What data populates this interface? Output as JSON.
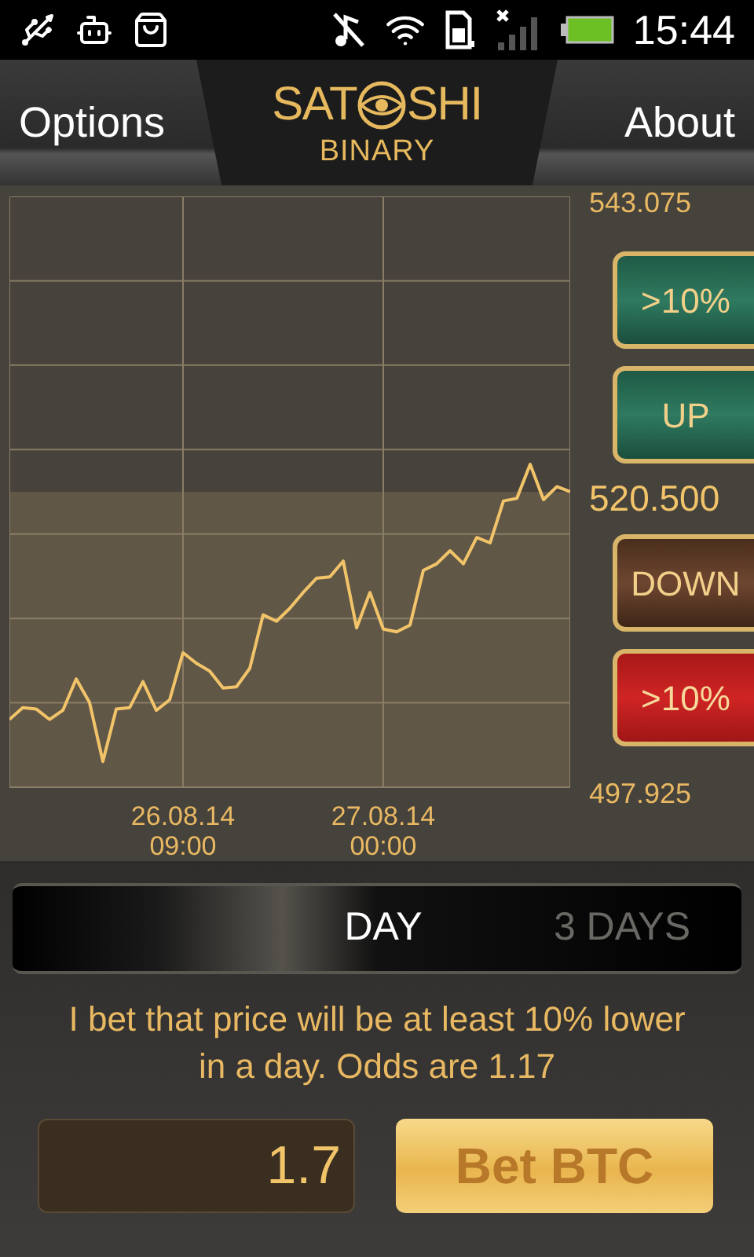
{
  "status_bar": {
    "time": "15:44"
  },
  "header": {
    "left_button": "Options",
    "right_button": "About",
    "logo": {
      "left": "SAT",
      "right": "SHI",
      "subtitle": "BINARY"
    }
  },
  "chart_data": {
    "type": "line",
    "ylim": [
      497.925,
      543.075
    ],
    "categories": [
      null,
      null,
      null,
      null,
      null,
      null,
      null,
      null,
      null,
      null,
      null,
      null,
      null,
      "26.08.14 09:00",
      null,
      null,
      null,
      null,
      null,
      null,
      null,
      null,
      null,
      null,
      null,
      null,
      null,
      null,
      "27.08.14 00:00",
      null,
      null,
      null,
      null,
      null,
      null,
      null,
      null,
      null,
      null,
      null,
      null,
      null,
      null
    ],
    "yticks": [
      {
        "value": 543.075,
        "label": "543.075"
      },
      {
        "value": 520.5,
        "label": "520.500"
      },
      {
        "value": 497.925,
        "label": "497.925"
      }
    ],
    "bands": [
      {
        "axis": "y",
        "from": 497.925,
        "to": 520.5,
        "color": "#615747"
      }
    ],
    "series": [
      {
        "color": "#f2c46a",
        "values": [
          503.1,
          504.0,
          503.9,
          503.1,
          503.8,
          506.2,
          504.4,
          499.9,
          503.9,
          504.0,
          506.0,
          503.8,
          504.6,
          508.2,
          507.4,
          506.8,
          505.5,
          505.6,
          507.0,
          511.1,
          510.6,
          511.6,
          512.8,
          513.9,
          514.0,
          515.2,
          510.1,
          512.8,
          510.0,
          509.8,
          510.3,
          514.5,
          515.0,
          516.0,
          515.0,
          517.0,
          516.6,
          519.8,
          520.0,
          522.6,
          519.9,
          520.9,
          520.5
        ]
      }
    ]
  },
  "bet_buttons": [
    {
      "label": ">10%",
      "kind": "up"
    },
    {
      "label": "UP",
      "kind": "up"
    },
    {
      "label": "DOWN",
      "kind": "down"
    },
    {
      "label": ">10%",
      "kind": "strong_down"
    }
  ],
  "period_tabs": [
    {
      "label": "DAY",
      "selected": true
    },
    {
      "label": "3 DAYS",
      "selected": false
    }
  ],
  "description": "I bet that price will be at least 10% lower in a day. Odds are 1.17",
  "amount_field": {
    "value": "1.7"
  },
  "bet_button": "Bet BTC"
}
